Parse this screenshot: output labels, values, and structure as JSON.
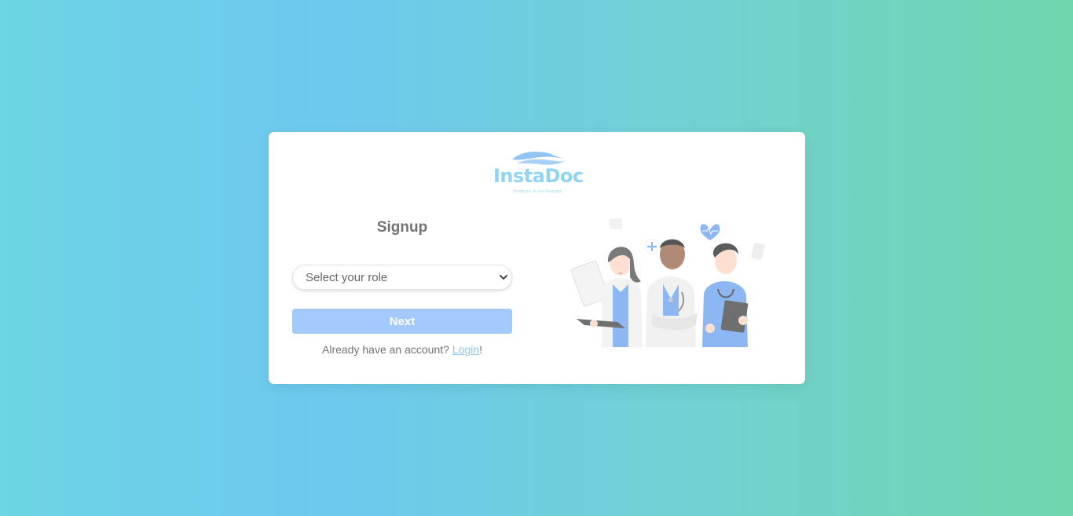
{
  "logo": {
    "name": "InstaDoc",
    "tagline": "Healthcare at your fingertips"
  },
  "signup": {
    "title": "Signup",
    "role_select": {
      "selected": "Select your role"
    },
    "next_label": "Next",
    "login_prompt": "Already have an account?",
    "login_link": "Login",
    "login_suffix": "!"
  },
  "colors": {
    "accent": "#a3c9fa",
    "link": "#8ec3ef",
    "logo": "#90d3f2",
    "background_start": "#6dd5e3",
    "background_end": "#70d6ae"
  },
  "illustration": {
    "icon": "doctors-team-illustration"
  }
}
